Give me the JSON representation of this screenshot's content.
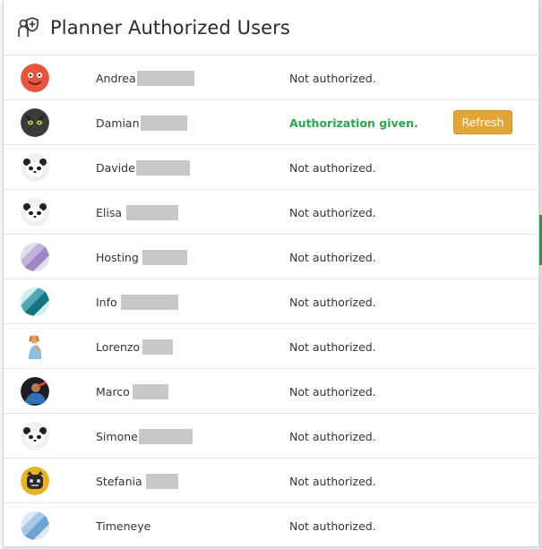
{
  "dialog": {
    "title": "Planner Authorized Users",
    "icon": "user-shield-icon"
  },
  "colors": {
    "authorized": "#2ea44f",
    "refresh_button": "#e2a538",
    "redaction": "#c8c8c8"
  },
  "users": [
    {
      "name": "Andrea",
      "status": "Not authorized.",
      "authorized": false,
      "avatar": "red-ball-avatar"
    },
    {
      "name": "Damian",
      "status": "Authorization given.",
      "authorized": true,
      "action_label": "Refresh",
      "avatar": "black-cat-avatar"
    },
    {
      "name": "Davide",
      "status": "Not authorized.",
      "authorized": false,
      "avatar": "panda-avatar"
    },
    {
      "name": "Elisa",
      "status": "Not authorized.",
      "authorized": false,
      "avatar": "panda-avatar"
    },
    {
      "name": "Hosting",
      "status": "Not authorized.",
      "authorized": false,
      "avatar": "purple-stripe-avatar"
    },
    {
      "name": "Info",
      "status": "Not authorized.",
      "authorized": false,
      "avatar": "teal-stripe-avatar"
    },
    {
      "name": "Lorenzo",
      "status": "Not authorized.",
      "authorized": false,
      "avatar": "praying-figure-avatar"
    },
    {
      "name": "Marco",
      "status": "Not authorized.",
      "authorized": false,
      "avatar": "photo-avatar"
    },
    {
      "name": "Simone",
      "status": "Not authorized.",
      "authorized": false,
      "avatar": "panda-avatar"
    },
    {
      "name": "Stefania",
      "status": "Not authorized.",
      "authorized": false,
      "avatar": "black-cat-yellow-avatar"
    },
    {
      "name": "Timeneye",
      "status": "Not authorized.",
      "authorized": false,
      "avatar": "blue-stripe-avatar"
    }
  ]
}
